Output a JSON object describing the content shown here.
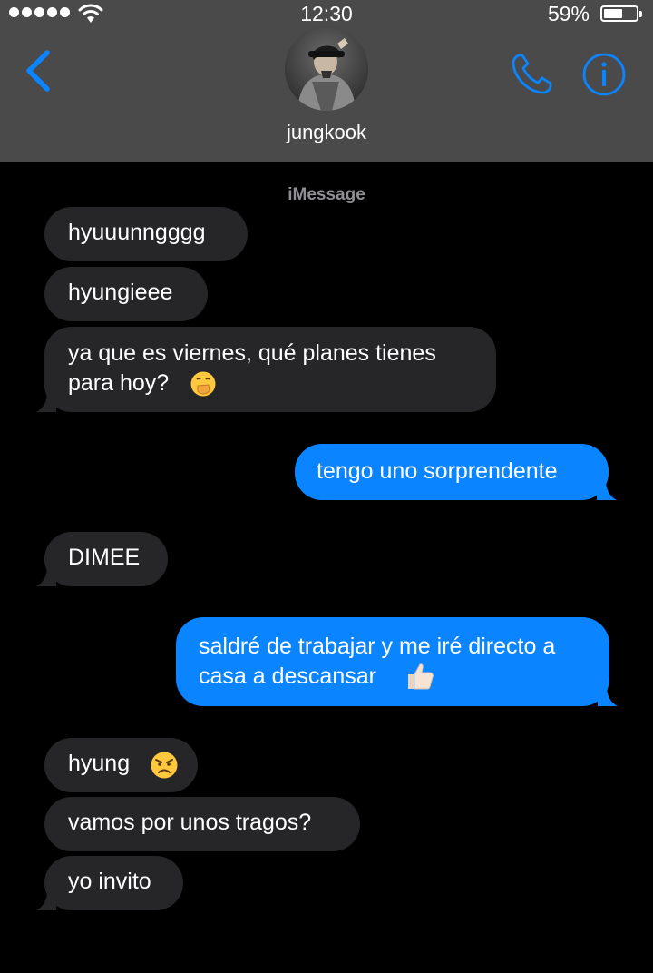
{
  "status_bar": {
    "time": "12:30",
    "battery_percent": "59%",
    "battery_level": 0.59
  },
  "header": {
    "contact_name": "jungkook"
  },
  "conversation": {
    "service_label": "iMessage",
    "messages": [
      {
        "side": "incoming",
        "text": "hyuuunngggg"
      },
      {
        "side": "incoming",
        "text": "hyungieee"
      },
      {
        "side": "incoming",
        "text": "ya que es viernes, qué planes tienes\npara hoy?",
        "emoji": "face-with-hand-over-mouth"
      },
      {
        "side": "outgoing",
        "text": "tengo uno sorprendente"
      },
      {
        "side": "incoming",
        "text": "DIMEE"
      },
      {
        "side": "outgoing",
        "text": "saldré de trabajar y me iré directo a\ncasa a descansar",
        "emoji": "thumbs-up"
      },
      {
        "side": "incoming",
        "text": "hyung",
        "emoji": "angry-face"
      },
      {
        "side": "incoming",
        "text": "vamos por unos tragos?"
      },
      {
        "side": "incoming",
        "text": "yo invito"
      }
    ]
  },
  "colors": {
    "header_background": "#4a4a4a",
    "accent_blue": "#0a84ff",
    "incoming_bubble": "#262628",
    "background": "#000000"
  }
}
